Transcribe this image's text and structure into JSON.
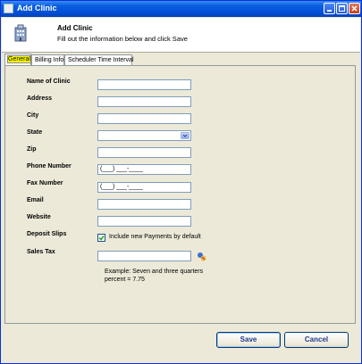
{
  "window": {
    "title": "Add Clinic"
  },
  "header": {
    "title": "Add Clinic",
    "subtitle": "Fill out the information below and click Save",
    "icon": "building-icon"
  },
  "tabs": [
    {
      "label": "General",
      "active": true
    },
    {
      "label": "Billing Info",
      "active": false
    },
    {
      "label": "Scheduler Time Interval",
      "active": false
    }
  ],
  "form": {
    "name_label": "Name of Clinic",
    "name_value": "",
    "address_label": "Address",
    "address_value": "",
    "city_label": "City",
    "city_value": "",
    "state_label": "State",
    "state_value": "",
    "zip_label": "Zip",
    "zip_value": "",
    "phone_label": "Phone Number",
    "phone_value": "(___) ___-____",
    "fax_label": "Fax Number",
    "fax_value": "(___) ___-____",
    "email_label": "Email",
    "email_value": "",
    "website_label": "Website",
    "website_value": "",
    "deposit_label": "Deposit Slips",
    "deposit_checkbox_label": "Include new Payments by default",
    "deposit_checked": true,
    "sales_tax_label": "Sales Tax",
    "sales_tax_value": "",
    "sales_tax_note": "Example: Seven and three quarters percent = 7.75"
  },
  "buttons": {
    "save": "Save",
    "cancel": "Cancel"
  }
}
